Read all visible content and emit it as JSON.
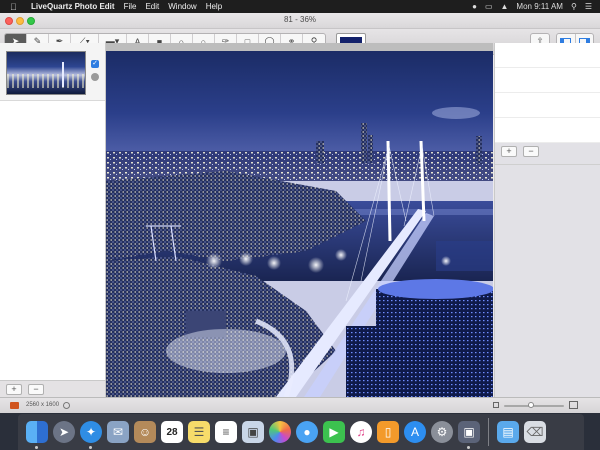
{
  "menubar": {
    "app_name": "LiveQuartz Photo Edit",
    "menus": [
      "File",
      "Edit",
      "Window",
      "Help"
    ],
    "clock": "Mon 9:11 AM"
  },
  "window": {
    "title": "81 - 36%"
  },
  "toolbar": {
    "tools": [
      "pointer",
      "brush",
      "pen",
      "line",
      "gradient",
      "text",
      "eraser",
      "stamp",
      "blur",
      "eyedropper",
      "rect-select",
      "ellipse-select",
      "lasso",
      "zoom"
    ],
    "active_tool": "pointer",
    "current_color": "#13216b"
  },
  "layers": {
    "items": [
      {
        "visible": true
      }
    ]
  },
  "status": {
    "image_size": "2560 x 1600",
    "zoom_fraction": 0.45
  },
  "dock": {
    "apps": [
      "finder",
      "launchpad",
      "safari",
      "mail-stamp",
      "contacts",
      "calendar",
      "notes",
      "reminders",
      "preview",
      "photos",
      "messages",
      "facetime",
      "itunes",
      "ibooks",
      "app-store",
      "system-preferences",
      "livequartz"
    ],
    "calendar_day": "28"
  }
}
